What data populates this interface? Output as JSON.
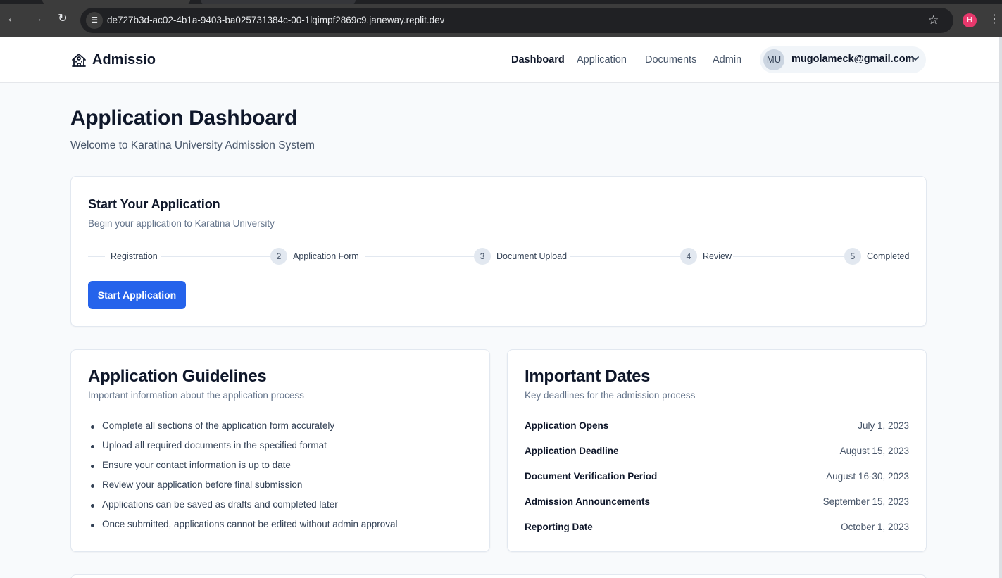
{
  "browser": {
    "url": "de727b3d-ac02-4b1a-9403-ba025731384c-00-1lqimpf2869c9.janeway.replit.dev",
    "profile_initial": "H"
  },
  "header": {
    "brand": "Admissio",
    "nav": [
      "Dashboard",
      "Application",
      "Documents",
      "Admin"
    ],
    "active_nav": "Dashboard",
    "user": {
      "initials": "MU",
      "email": "mugolameck@gmail.com"
    }
  },
  "page": {
    "title": "Application Dashboard",
    "subtitle": "Welcome to Karatina University Admission System"
  },
  "start_card": {
    "title": "Start Your Application",
    "subtitle": "Begin your application to Karatina University",
    "steps": [
      {
        "num": "",
        "label": "Registration"
      },
      {
        "num": "2",
        "label": "Application Form"
      },
      {
        "num": "3",
        "label": "Document Upload"
      },
      {
        "num": "4",
        "label": "Review"
      },
      {
        "num": "5",
        "label": "Completed"
      }
    ],
    "button": "Start Application"
  },
  "guidelines": {
    "title": "Application Guidelines",
    "subtitle": "Important information about the application process",
    "items": [
      "Complete all sections of the application form accurately",
      "Upload all required documents in the specified format",
      "Ensure your contact information is up to date",
      "Review your application before final submission",
      "Applications can be saved as drafts and completed later",
      "Once submitted, applications cannot be edited without admin approval"
    ]
  },
  "dates": {
    "title": "Important Dates",
    "subtitle": "Key deadlines for the admission process",
    "rows": [
      {
        "name": "Application Opens",
        "date": "July 1, 2023"
      },
      {
        "name": "Application Deadline",
        "date": "August 15, 2023"
      },
      {
        "name": "Document Verification Period",
        "date": "August 16-30, 2023"
      },
      {
        "name": "Admission Announcements",
        "date": "September 15, 2023"
      },
      {
        "name": "Reporting Date",
        "date": "October 1, 2023"
      }
    ]
  },
  "colors": {
    "primary": "#2563eb",
    "page_bg": "#f8fafc",
    "text": "#0f172a",
    "muted": "#64748b"
  }
}
